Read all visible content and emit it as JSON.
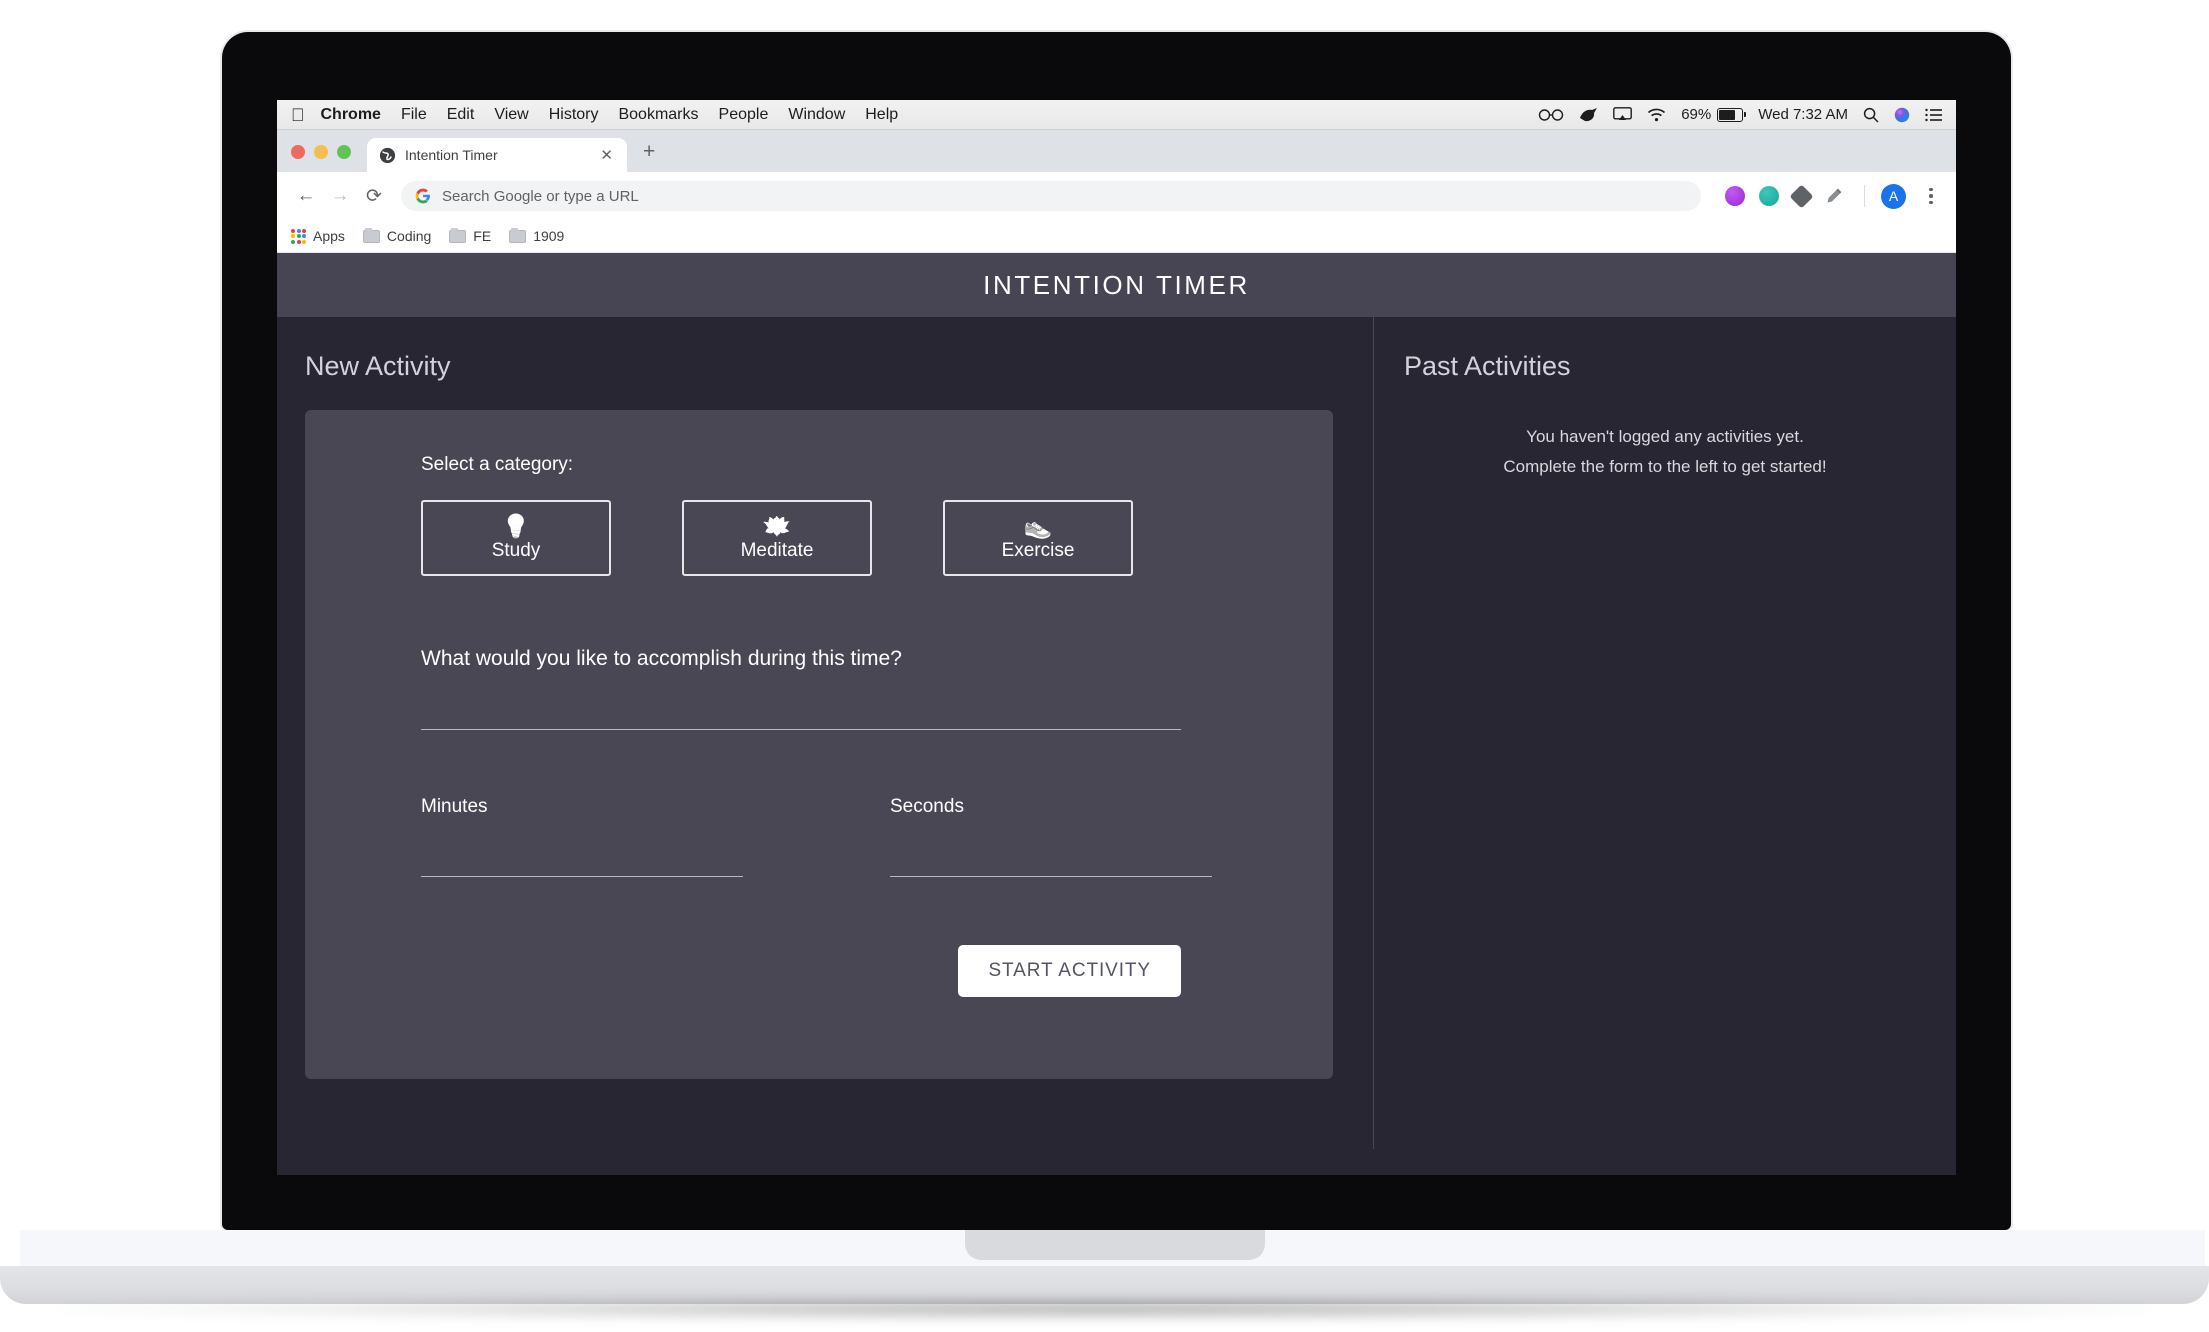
{
  "os": {
    "menubar": {
      "apple_icon": "apple-logo-icon",
      "items": [
        "Chrome",
        "File",
        "Edit",
        "View",
        "History",
        "Bookmarks",
        "People",
        "Window",
        "Help"
      ],
      "status": {
        "glasses_icon": "glasses-icon",
        "bird_icon": "bird-icon",
        "airplay_icon": "airplay-icon",
        "wifi_icon": "wifi-icon",
        "battery_percent": "69%",
        "battery_icon": "battery-icon",
        "clock": "Wed 7:32 AM",
        "search_icon": "spotlight-search-icon",
        "siri_icon": "siri-icon",
        "notifications_icon": "notification-center-icon"
      }
    }
  },
  "browser": {
    "tab": {
      "title": "Intention Timer",
      "favicon": "globe-favicon",
      "close_label": "✕"
    },
    "new_tab_label": "+",
    "nav": {
      "back": "←",
      "forward": "→",
      "reload": "⟳"
    },
    "omnibox": {
      "placeholder": "Search Google or type a URL",
      "value": "",
      "search_engine_icon": "google-g-icon"
    },
    "extensions": [
      {
        "name": "extension-purple-icon"
      },
      {
        "name": "extension-teal-icon"
      },
      {
        "name": "extension-diamond-icon"
      },
      {
        "name": "highlighter-pen-icon"
      }
    ],
    "profile_initial": "A",
    "menu_icon": "three-dot-menu-icon",
    "bookmarks": [
      {
        "label": "Apps",
        "icon": "apps-grid-icon"
      },
      {
        "label": "Coding",
        "icon": "folder-icon"
      },
      {
        "label": "FE",
        "icon": "folder-icon"
      },
      {
        "label": "1909",
        "icon": "folder-icon"
      }
    ]
  },
  "app": {
    "title": "INTENTION TIMER",
    "new_activity": {
      "heading": "New Activity",
      "category_label": "Select a category:",
      "categories": [
        {
          "label": "Study",
          "emoji": "💡",
          "icon": "lightbulb-book-icon"
        },
        {
          "label": "Meditate",
          "emoji": "🪷",
          "icon": "lotus-flower-icon"
        },
        {
          "label": "Exercise",
          "emoji": "👟",
          "icon": "running-shoe-icon"
        }
      ],
      "goal_label": "What would you like to accomplish during this time?",
      "goal_value": "",
      "goal_placeholder": "",
      "minutes_label": "Minutes",
      "minutes_value": "",
      "seconds_label": "Seconds",
      "seconds_value": "",
      "submit_label": "START ACTIVITY"
    },
    "past_activities": {
      "heading": "Past Activities",
      "empty_line_1": "You haven't logged any activities yet.",
      "empty_line_2": "Complete the form to the left to get started!"
    },
    "colors": {
      "page_background": "#282633",
      "header_background": "#474453",
      "card_background": "#4a4755",
      "text_primary": "#ffffff",
      "text_muted": "#d3d1da",
      "button_background": "#ffffff",
      "button_text": "#565362"
    }
  }
}
